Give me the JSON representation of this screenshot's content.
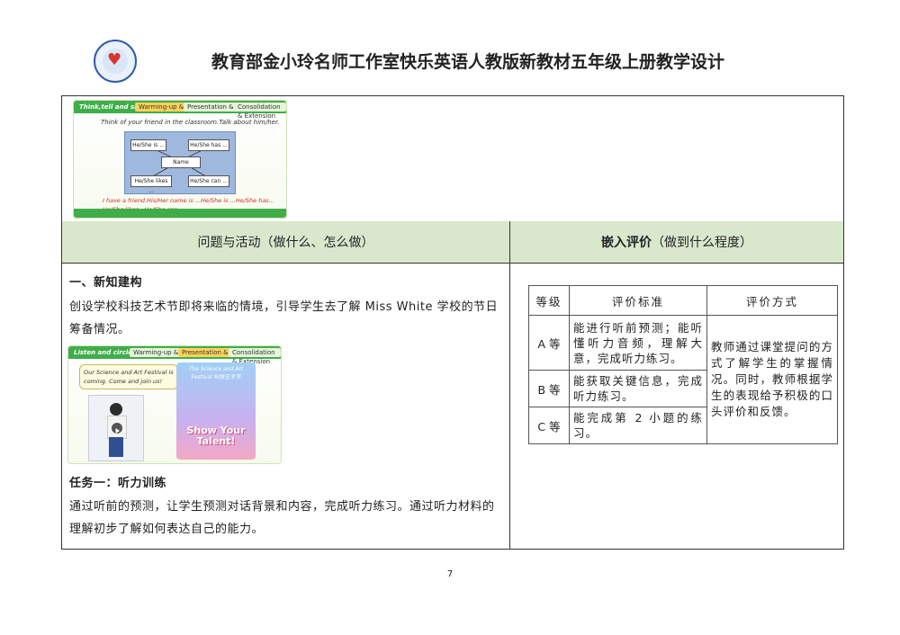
{
  "header": {
    "title": "教育部金小玲名师工作室快乐英语人教版新教材五年级上册教学设计"
  },
  "slide_top": {
    "tabs": [
      "Think,tell and say",
      "Warming-up & Revision",
      "Presentation & Practice",
      "Consolidation & Extension"
    ],
    "prompt": "Think of your friend in the classroom.Talk about him/her.",
    "nodes": {
      "center": "Name",
      "tl": "He/She is ...",
      "tr": "He/She has ...",
      "bl": "He/She likes ...",
      "br": "He/She can ..."
    },
    "sentence": "I have a friend.His/Her name is ...He/She is ...He/She has... He/She likes...He/She can..."
  },
  "table_headers": {
    "left": "问题与活动（做什么、怎么做）",
    "right_bold": "嵌入评价",
    "right_rest": "（做到什么程度）"
  },
  "left": {
    "section": "一、新知建构",
    "intro": "创设学校科技艺术节即将来临的情境，引导学生去了解 Miss White 学校的节日筹备情况。",
    "task_title": "任务一：听力训练",
    "task_desc": "通过听前的预测，让学生预测对话背景和内容，完成听力练习。通过听力材料的理解初步了解如何表达自己的能力。"
  },
  "slide_mid": {
    "tabs": [
      "Listen and circle",
      "Warming-up & Revision",
      "Presentation & Practice",
      "Consolidation & Extension"
    ],
    "bubble": "Our Science and Art Festival is coming. Come and join us!",
    "poster_title": "The Science and Art Festival 科技艺术节",
    "poster_slogan": "Show Your Talent!"
  },
  "eval": {
    "headers": [
      "等级",
      "评价标准",
      "评价方式"
    ],
    "rows": [
      {
        "grade": "A 等",
        "criterion": "能进行听前预测；能听懂听力音频，理解大意，完成听力练习。"
      },
      {
        "grade": "B 等",
        "criterion": "能获取关键信息，完成听力练习。"
      },
      {
        "grade": "C 等",
        "criterion": "能完成第 2 小题的练习。"
      }
    ],
    "method": "教师通过课堂提问的方式了解学生的掌握情况。同时，教师根据学生的表现给予积极的口头评价和反馈。"
  },
  "footer": {
    "page_number": "7"
  },
  "colors": {
    "header_fill": "#d9e8cd",
    "slide_green": "#3fae4a",
    "slide_red_text": "#d12a2a"
  }
}
